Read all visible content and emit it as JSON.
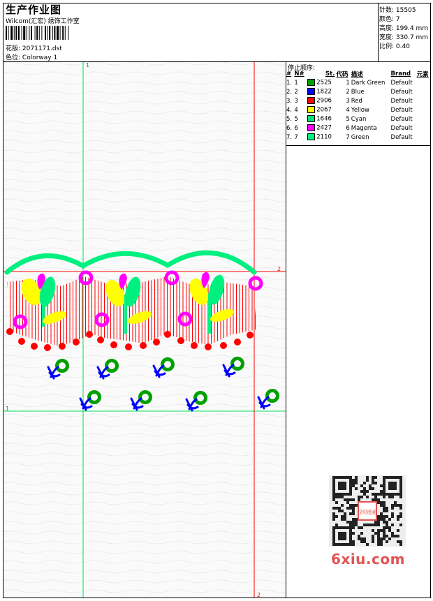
{
  "header": {
    "title": "生产作业图",
    "company": "Wilcom(汇宏) 绣饰工作室",
    "design_label": "花版:",
    "design_value": "2071171.dst",
    "colorway_label": "色位:",
    "colorway_value": "Colorway 1"
  },
  "info": [
    {
      "label": "针数:",
      "value": "15505"
    },
    {
      "label": "颜色:",
      "value": "7"
    },
    {
      "label": "高度:",
      "value": "199.4 mm"
    },
    {
      "label": "宽度:",
      "value": "330.7 mm"
    },
    {
      "label": "比例:",
      "value": "0.40"
    }
  ],
  "guides": {
    "green_top": "1",
    "green_left": "1",
    "red_right": "2",
    "red_bottom": "2"
  },
  "thread_table": {
    "title": "停止顺序:",
    "headers": [
      "#",
      "N#",
      "St.",
      "代码",
      "描述",
      "Brand",
      "元素"
    ],
    "rows": [
      {
        "seq": "1.",
        "n": "1",
        "code": "2525",
        "num": "1",
        "desc": "Dark Green",
        "brand": "Default",
        "color": "#00a000"
      },
      {
        "seq": "2.",
        "n": "2",
        "code": "1822",
        "num": "2",
        "desc": "Blue",
        "brand": "Default",
        "color": "#0000ff"
      },
      {
        "seq": "3.",
        "n": "3",
        "code": "2906",
        "num": "3",
        "desc": "Red",
        "brand": "Default",
        "color": "#ff0000"
      },
      {
        "seq": "4.",
        "n": "4",
        "code": "2067",
        "num": "4",
        "desc": "Yellow",
        "brand": "Default",
        "color": "#ffff00"
      },
      {
        "seq": "5.",
        "n": "5",
        "code": "1646",
        "num": "5",
        "desc": "Cyan",
        "brand": "Default",
        "color": "#00e07a"
      },
      {
        "seq": "6.",
        "n": "6",
        "code": "2427",
        "num": "6",
        "desc": "Magenta",
        "brand": "Default",
        "color": "#ff00ff"
      },
      {
        "seq": "7.",
        "n": "7",
        "code": "2110",
        "num": "7",
        "desc": "Green",
        "brand": "Default",
        "color": "#00f080"
      }
    ]
  },
  "watermark": {
    "site": "6xiu.com",
    "seal": "汉阳图纸"
  }
}
